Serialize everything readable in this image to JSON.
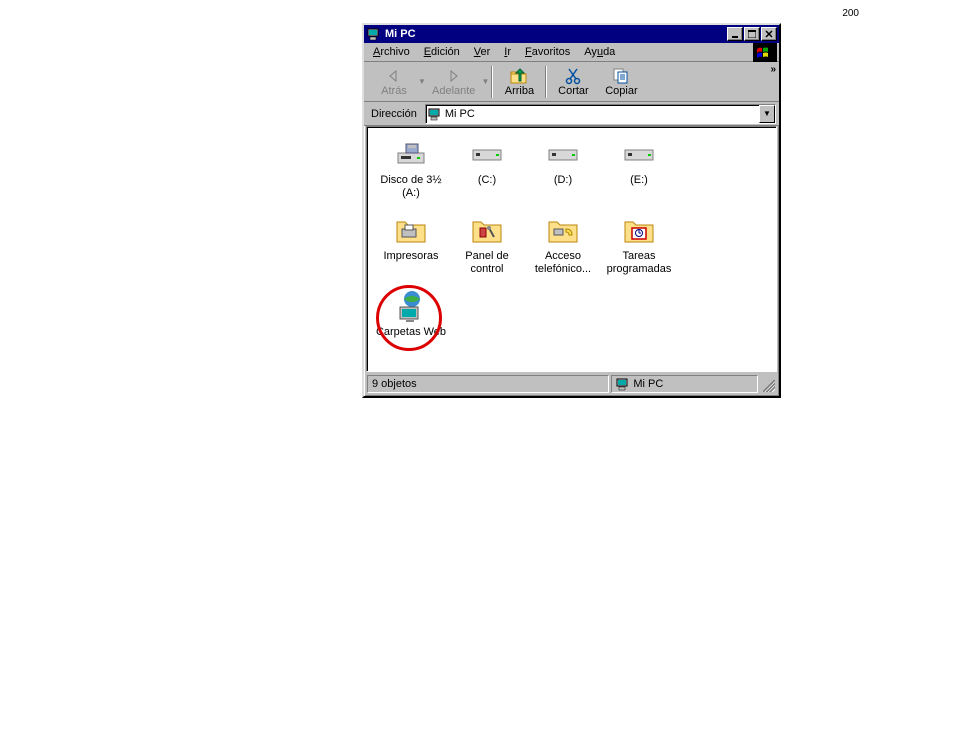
{
  "page_number": "200",
  "window": {
    "title": "Mi PC"
  },
  "menubar": {
    "items": [
      {
        "label": "Archivo",
        "underline_index": 0
      },
      {
        "label": "Edición",
        "underline_index": 0
      },
      {
        "label": "Ver",
        "underline_index": 0
      },
      {
        "label": "Ir",
        "underline_index": 0
      },
      {
        "label": "Favoritos",
        "underline_index": 0
      },
      {
        "label": "Ayuda",
        "underline_index": 2
      }
    ]
  },
  "toolbar": {
    "buttons": [
      {
        "label": "Atrás",
        "icon": "arrow-left",
        "disabled": true,
        "caret": true
      },
      {
        "label": "Adelante",
        "icon": "arrow-right",
        "disabled": true,
        "caret": true
      },
      {
        "label": "Arriba",
        "icon": "folder-up",
        "disabled": false,
        "caret": false
      },
      {
        "label": "Cortar",
        "icon": "scissors",
        "disabled": false,
        "caret": false
      },
      {
        "label": "Copiar",
        "icon": "copy",
        "disabled": false,
        "caret": false
      }
    ],
    "more": "»"
  },
  "addressbar": {
    "label": "Dirección",
    "value": "Mi PC"
  },
  "content": {
    "items": [
      {
        "label": "Disco de 3½ (A:)",
        "icon": "floppy"
      },
      {
        "label": "(C:)",
        "icon": "hdd"
      },
      {
        "label": "(D:)",
        "icon": "hdd"
      },
      {
        "label": "(E:)",
        "icon": "hdd"
      },
      {
        "label": "Impresoras",
        "icon": "folder-printer"
      },
      {
        "label": "Panel de control",
        "icon": "folder-tools"
      },
      {
        "label": "Acceso telefónico...",
        "icon": "folder-phone"
      },
      {
        "label": "Tareas programadas",
        "icon": "folder-clock"
      },
      {
        "label": "Carpetas Web",
        "icon": "web-folder",
        "highlighted": true
      }
    ]
  },
  "statusbar": {
    "left": "9 objetos",
    "right": "Mi PC"
  }
}
